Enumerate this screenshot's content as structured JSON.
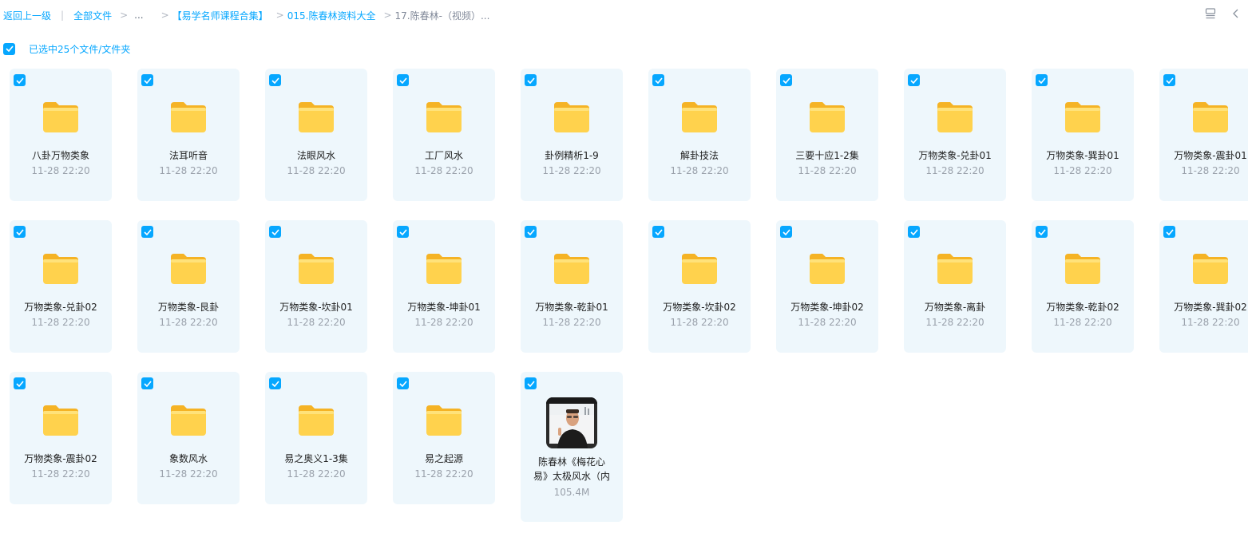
{
  "breadcrumb": {
    "back": "返回上一级",
    "all_files": "全部文件",
    "ellipsis": "...",
    "item1": "【易学名师课程合集】",
    "item2": "015.陈春林资料大全",
    "current": "17.陈春林-（视频）..."
  },
  "selection": {
    "label": "已选中25个文件/文件夹"
  },
  "colors": {
    "accent": "#06a7ff",
    "tile_bg": "#eef7fc",
    "folder": "#ffd24d"
  },
  "items": [
    {
      "name": "八卦万物类象",
      "date": "11-28 22:20",
      "type": "folder"
    },
    {
      "name": "法耳听音",
      "date": "11-28 22:20",
      "type": "folder"
    },
    {
      "name": "法眼风水",
      "date": "11-28 22:20",
      "type": "folder"
    },
    {
      "name": "工厂风水",
      "date": "11-28 22:20",
      "type": "folder"
    },
    {
      "name": "卦例精析1-9",
      "date": "11-28 22:20",
      "type": "folder"
    },
    {
      "name": "解卦技法",
      "date": "11-28 22:20",
      "type": "folder"
    },
    {
      "name": "三要十应1-2集",
      "date": "11-28 22:20",
      "type": "folder"
    },
    {
      "name": "万物类象-兑卦01",
      "date": "11-28 22:20",
      "type": "folder"
    },
    {
      "name": "万物类象-巽卦01",
      "date": "11-28 22:20",
      "type": "folder"
    },
    {
      "name": "万物类象-震卦01",
      "date": "11-28 22:20",
      "type": "folder"
    },
    {
      "name": "万物类象-兑卦02",
      "date": "11-28 22:20",
      "type": "folder"
    },
    {
      "name": "万物类象-艮卦",
      "date": "11-28 22:20",
      "type": "folder"
    },
    {
      "name": "万物类象-坎卦01",
      "date": "11-28 22:20",
      "type": "folder"
    },
    {
      "name": "万物类象-坤卦01",
      "date": "11-28 22:20",
      "type": "folder"
    },
    {
      "name": "万物类象-乾卦01",
      "date": "11-28 22:20",
      "type": "folder"
    },
    {
      "name": "万物类象-坎卦02",
      "date": "11-28 22:20",
      "type": "folder"
    },
    {
      "name": "万物类象-坤卦02",
      "date": "11-28 22:20",
      "type": "folder"
    },
    {
      "name": "万物类象-离卦",
      "date": "11-28 22:20",
      "type": "folder"
    },
    {
      "name": "万物类象-乾卦02",
      "date": "11-28 22:20",
      "type": "folder"
    },
    {
      "name": "万物类象-巽卦02",
      "date": "11-28 22:20",
      "type": "folder"
    },
    {
      "name": "万物类象-震卦02",
      "date": "11-28 22:20",
      "type": "folder"
    },
    {
      "name": "象数风水",
      "date": "11-28 22:20",
      "type": "folder"
    },
    {
      "name": "易之奥义1-3集",
      "date": "11-28 22:20",
      "type": "folder"
    },
    {
      "name": "易之起源",
      "date": "11-28 22:20",
      "type": "folder"
    },
    {
      "name": "陈春林《梅花心易》太极风水（内",
      "size": "105.4M",
      "type": "video"
    }
  ]
}
